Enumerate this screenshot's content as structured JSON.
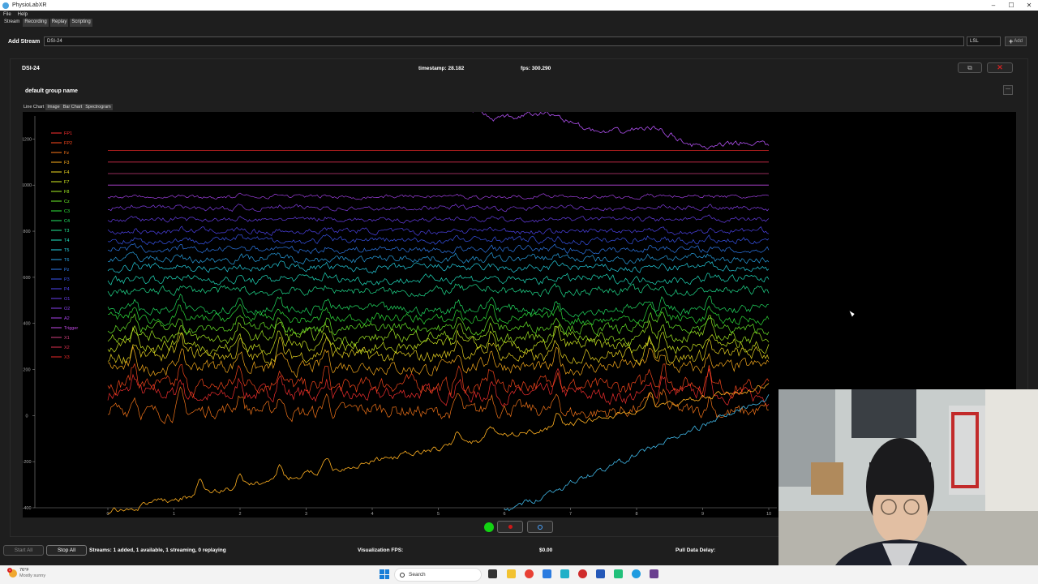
{
  "window": {
    "title": "PhysioLabXR",
    "controls": [
      "–",
      "☐",
      "✕"
    ]
  },
  "menu": [
    "File",
    "Help"
  ],
  "tabs": [
    {
      "label": "Stream",
      "active": true
    },
    {
      "label": "Recording",
      "active": false
    },
    {
      "label": "Replay",
      "active": false
    },
    {
      "label": "Scripting",
      "active": false
    }
  ],
  "add_stream": {
    "label": "Add Stream",
    "name_value": "DSI-24",
    "interface_value": "LSL",
    "add_label": "Add"
  },
  "stream": {
    "name": "DSI-24",
    "timestamp": "timestamp: 28.182",
    "fps": "fps: 300.290",
    "group_name": "default group name",
    "viz_tabs": [
      "Line Chart",
      "Image",
      "Bar Chart",
      "Spectrogram"
    ],
    "active_viz_tab": "Line Chart"
  },
  "chart_data": {
    "type": "line",
    "title": "",
    "xlabel": "",
    "ylabel": "",
    "xlim": [
      0,
      10
    ],
    "ylim": [
      -400,
      1300
    ],
    "x_ticks": [
      "0",
      "1",
      "2",
      "3",
      "4",
      "5",
      "6",
      "7",
      "8",
      "9",
      "10"
    ],
    "y_ticks": [
      "-400",
      "-200",
      "0",
      "200",
      "400",
      "600",
      "800",
      "1000",
      "1200"
    ],
    "legend_position": "top-left",
    "series": [
      {
        "name": "FP1",
        "color": "#ff3030",
        "baseline": 90,
        "amp": 30,
        "kind": "eeg"
      },
      {
        "name": "FP2",
        "color": "#ff4a1e",
        "baseline": 130,
        "amp": 34,
        "kind": "eeg"
      },
      {
        "name": "Fz",
        "color": "#ff7a1a",
        "baseline": 20,
        "amp": 30,
        "kind": "eeg"
      },
      {
        "name": "F3",
        "color": "#ffb01c",
        "baseline": 210,
        "amp": 28,
        "kind": "eeg"
      },
      {
        "name": "F4",
        "color": "#f2dc22",
        "baseline": 260,
        "amp": 28,
        "kind": "eeg"
      },
      {
        "name": "F7",
        "color": "#d6f022",
        "baseline": 300,
        "amp": 26,
        "kind": "eeg"
      },
      {
        "name": "F8",
        "color": "#a6f024",
        "baseline": 340,
        "amp": 24,
        "kind": "eeg"
      },
      {
        "name": "Cz",
        "color": "#6cf02a",
        "baseline": 380,
        "amp": 22,
        "kind": "eeg"
      },
      {
        "name": "C3",
        "color": "#30e83c",
        "baseline": 420,
        "amp": 20,
        "kind": "eeg"
      },
      {
        "name": "C4",
        "color": "#24e866",
        "baseline": 460,
        "amp": 20,
        "kind": "eeg"
      },
      {
        "name": "T3",
        "color": "#22e896",
        "baseline": 540,
        "amp": 18,
        "kind": "eeg"
      },
      {
        "name": "T4",
        "color": "#22e8c6",
        "baseline": 590,
        "amp": 18,
        "kind": "eeg"
      },
      {
        "name": "T5",
        "color": "#26d6e8",
        "baseline": 640,
        "amp": 16,
        "kind": "eeg"
      },
      {
        "name": "T6",
        "color": "#2aa8ec",
        "baseline": 680,
        "amp": 16,
        "kind": "eeg"
      },
      {
        "name": "Pz",
        "color": "#2e7cf0",
        "baseline": 720,
        "amp": 14,
        "kind": "eeg"
      },
      {
        "name": "P3",
        "color": "#3a56f2",
        "baseline": 760,
        "amp": 14,
        "kind": "eeg"
      },
      {
        "name": "P4",
        "color": "#5046f2",
        "baseline": 800,
        "amp": 12,
        "kind": "eeg"
      },
      {
        "name": "O1",
        "color": "#6a40f0",
        "baseline": 850,
        "amp": 10,
        "kind": "eeg"
      },
      {
        "name": "O2",
        "color": "#8840ee",
        "baseline": 900,
        "amp": 10,
        "kind": "eeg"
      },
      {
        "name": "A2",
        "color": "#a842ec",
        "baseline": 950,
        "amp": 8,
        "kind": "eeg"
      },
      {
        "name": "Trigger",
        "color": "#c44ae8",
        "baseline": 1000,
        "amp": 0,
        "kind": "flat"
      },
      {
        "name": "X1",
        "color": "#d24080",
        "baseline": 1050,
        "amp": 0,
        "kind": "flat"
      },
      {
        "name": "X2",
        "color": "#e03050",
        "baseline": 1100,
        "amp": 0,
        "kind": "flat"
      },
      {
        "name": "X3",
        "color": "#e82828",
        "baseline": 1150,
        "amp": 0,
        "kind": "flat"
      }
    ],
    "extra_series": [
      {
        "color": "#b050f0",
        "kind": "drift-top"
      },
      {
        "color": "#ffb020",
        "kind": "drift-rising"
      },
      {
        "color": "#40b8e8",
        "kind": "drift-cyan"
      }
    ],
    "colors": {
      "background": "#000000",
      "axis": "#888888"
    }
  },
  "controls": {
    "connected_color": "#12d212",
    "record_color": "#d01818",
    "settings_color": "#4aa3ff"
  },
  "status": {
    "start_all": "Start All",
    "stop_all": "Stop All",
    "streams": "Streams: 1 added, 1 available, 1 streaming, 0 replaying",
    "viz_fps_label": "Visualization FPS:",
    "viz_fps_value": "$0.00",
    "pull_delay_label": "Pull Data Delay:"
  },
  "taskbar": {
    "weather_temp": "76°F",
    "weather_desc": "Mostly sunny",
    "weather_badge": "1",
    "search_label": "Search",
    "icons": [
      "windows-icon",
      "search-icon",
      "file-explorer-icon",
      "folder-icon",
      "chrome-icon",
      "store-icon",
      "terminal-icon",
      "app-icon",
      "word-icon",
      "pycharm-icon",
      "edge-icon",
      "slack-icon"
    ]
  }
}
